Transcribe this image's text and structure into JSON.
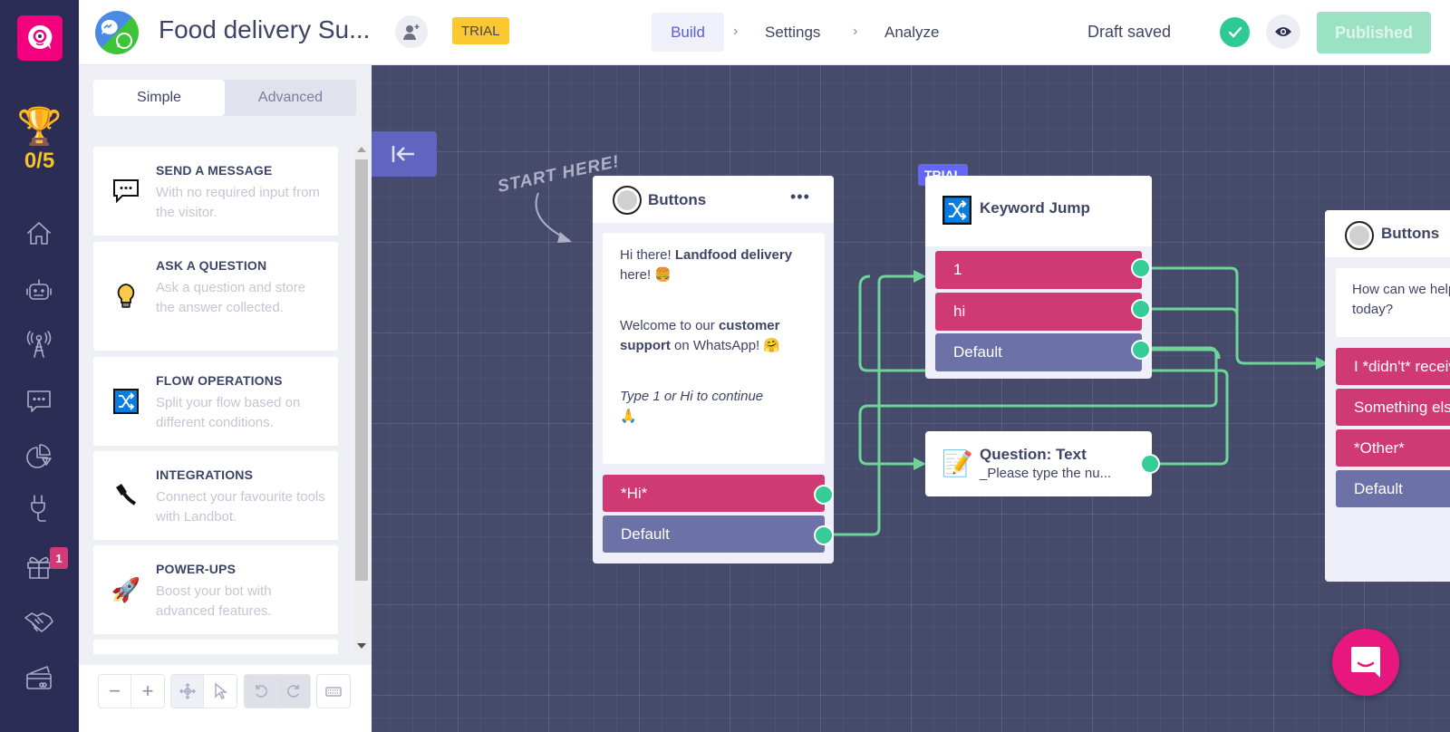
{
  "rail": {
    "logo": "landbot-logo-icon",
    "trophy": {
      "icon": "trophy-icon",
      "score": "0/5"
    },
    "items": [
      {
        "name": "home",
        "icon": "home-icon"
      },
      {
        "name": "bots",
        "icon": "robot-icon"
      },
      {
        "name": "channels",
        "icon": "antenna-icon"
      },
      {
        "name": "messages",
        "icon": "chat-icon"
      },
      {
        "name": "analytics",
        "icon": "pie-chart-icon"
      },
      {
        "name": "integrations",
        "icon": "plug-icon"
      },
      {
        "name": "gifts",
        "icon": "gift-icon",
        "badge": "1"
      },
      {
        "name": "partners",
        "icon": "handshake-icon"
      },
      {
        "name": "billing",
        "icon": "credit-card-icon"
      }
    ]
  },
  "header": {
    "title": "Food delivery Su...",
    "trial_label": "TRIAL",
    "nav": [
      {
        "label": "Build",
        "active": true
      },
      {
        "label": "Settings",
        "active": false
      },
      {
        "label": "Analyze",
        "active": false
      }
    ],
    "nav_separator": "›",
    "draft_status": "Draft saved",
    "published_label": "Published"
  },
  "panel": {
    "tabs": [
      {
        "label": "Simple",
        "active": true
      },
      {
        "label": "Advanced",
        "active": false
      }
    ],
    "blocks": [
      {
        "title": "SEND A MESSAGE",
        "desc": "With no required input from the visitor.",
        "icon": "💬"
      },
      {
        "title": "ASK A QUESTION",
        "desc": "Ask a question and store the answer collected.",
        "icon": "💡"
      },
      {
        "title": "FLOW OPERATIONS",
        "desc": "Split your flow based on different conditions.",
        "icon": "🔀"
      },
      {
        "title": "INTEGRATIONS",
        "desc": "Connect your favourite tools with Landbot.",
        "icon": "🔌"
      },
      {
        "title": "POWER-UPS",
        "desc": "Boost your bot with advanced features.",
        "icon": "🚀"
      }
    ],
    "toolbar": {
      "zoom_out": "−",
      "zoom_in": "+"
    }
  },
  "canvas": {
    "start_here": "START HERE!",
    "nodes": {
      "buttons1": {
        "title": "Buttons",
        "menu": "•••",
        "message": {
          "p1_a": "Hi there! ",
          "p1_b": "Landfood delivery",
          "p1_c": " here! 🍔",
          "p2_a": "Welcome to our ",
          "p2_b": "customer support",
          "p2_c": " on WhatsApp! 🤗",
          "p3": "Type 1 or Hi to continue",
          "p3_emoji": "🙏"
        },
        "options": [
          "*Hi*",
          "Default"
        ]
      },
      "keyword": {
        "trial": "TRIAL",
        "title": "Keyword Jump",
        "options": [
          "1",
          "hi",
          "Default"
        ]
      },
      "question": {
        "title": "Question: Text",
        "subtitle": "_Please type the nu...",
        "icon": "📝"
      },
      "buttons2": {
        "title": "Buttons",
        "message": "How can we help you today?",
        "options": [
          "I *didn't* receive my order",
          "Something else",
          "*Other*",
          "Default"
        ]
      }
    }
  },
  "colors": {
    "rail": "#2b2d55",
    "canvas": "#464b6b",
    "pink_option": "#cf3a72",
    "gray_option": "#6c72a8",
    "connector": "#6fd49a",
    "accent": "#5a5fd1",
    "published": "#9be2c5",
    "fab": "#e7177d"
  }
}
